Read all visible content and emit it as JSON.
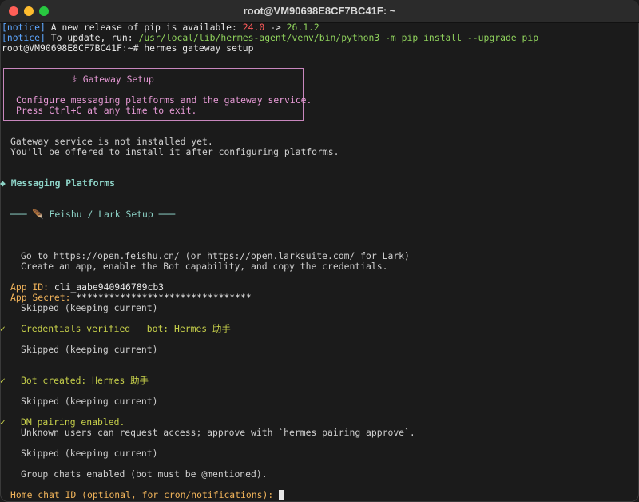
{
  "window": {
    "title": "root@VM90698E8CF7BC41F: ~"
  },
  "notice1": {
    "tag": "[notice]",
    "text": " A new release of pip is available: ",
    "old": "24.0",
    "arrow": " -> ",
    "new": "26.1.2"
  },
  "notice2": {
    "tag": "[notice]",
    "text": " To update, run: ",
    "cmd": "/usr/local/lib/hermes-agent/venv/bin/python3 -m pip install --upgrade pip"
  },
  "prompt_line": "root@VM90698E8CF7BC41F:~# hermes gateway setup",
  "setup_box": {
    "title": "⚕ Gateway Setup",
    "line1": "Configure messaging platforms and the gateway service.",
    "line2": "Press Ctrl+C at any time to exit."
  },
  "status": {
    "line1": "Gateway service is not installed yet.",
    "line2": "You'll be offered to install it after configuring platforms."
  },
  "section_header": "◆ Messaging Platforms",
  "subsection": "─── 🪶 Feishu / Lark Setup ───",
  "instructions": {
    "line1": "Go to https://open.feishu.cn/ (or https://open.larksuite.com/ for Lark)",
    "line2": "Create an app, enable the Bot capability, and copy the credentials."
  },
  "app_id": {
    "label": "App ID:",
    "value": " cli_aabe940946789cb3"
  },
  "app_secret": {
    "label": "App Secret:",
    "value": " ********************************"
  },
  "skipped": "Skipped (keeping current)",
  "check": "✓",
  "credentials_verified": "Credentials verified — bot: Hermes 助手",
  "bot_created": "Bot created: Hermes 助手",
  "dm_pairing": {
    "line1": "DM pairing enabled.",
    "line2": "Unknown users can request access; approve with `hermes pairing approve`."
  },
  "group_chats": "Group chats enabled (bot must be @mentioned).",
  "home_prompt": "Home chat ID (optional, for cron/notifications): "
}
